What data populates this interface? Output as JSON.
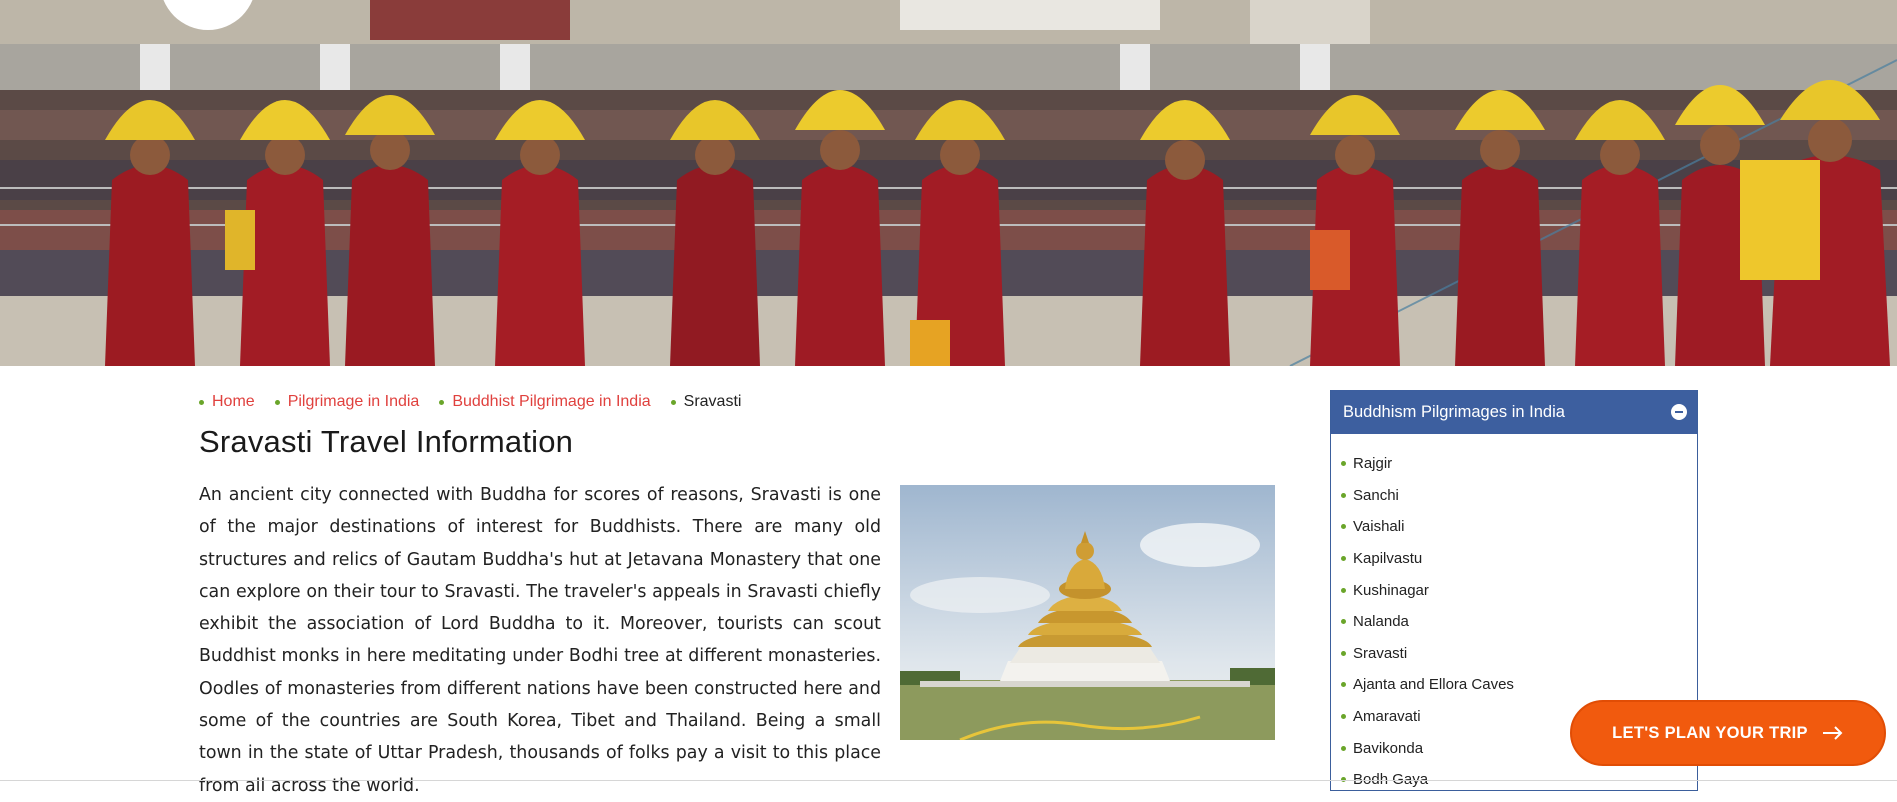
{
  "breadcrumb": [
    {
      "label": "Home",
      "link": true
    },
    {
      "label": "Pilgrimage in India",
      "link": true
    },
    {
      "label": "Buddhist Pilgrimage in India",
      "link": true
    },
    {
      "label": "Sravasti",
      "link": false
    }
  ],
  "page_title": "Sravasti Travel Information",
  "intro_text": "An ancient city connected with Buddha for scores of reasons, Sravasti is one of the major destinations of interest for Buddhists. There are many old structures and relics of Gautam Buddha's hut at Jetavana Monastery that one can explore on their tour to Sravasti. The traveler's appeals in Sravasti chiefly exhibit the association of Lord Buddha to it. Moreover, tourists can scout Buddhist monks in here meditating under Bodhi tree at different monasteries. Oodles of monasteries from different nations have been constructed here and some of the countries are South Korea, Tibet and Thailand. Being a small town in the state of Uttar Pradesh, thousands of folks pay a visit to this place from all across the world.",
  "sidebar": {
    "title": "Buddhism Pilgrimages in India",
    "items": [
      "Rajgir",
      "Sanchi",
      "Vaishali",
      "Kapilvastu",
      "Kushinagar",
      "Nalanda",
      "Sravasti",
      "Ajanta and Ellora Caves",
      "Amaravati",
      "Bavikonda",
      "Bodh Gaya"
    ]
  },
  "cta": {
    "label": "LET'S PLAN YOUR TRIP"
  },
  "colors": {
    "accent": "#e0413e",
    "bullet": "#6aa52a",
    "sidebar_header": "#3d5f9f",
    "cta": "#f15a0e"
  },
  "icons": [
    "site-logo-icon",
    "collapse-minus-icon",
    "arrow-right-icon"
  ]
}
